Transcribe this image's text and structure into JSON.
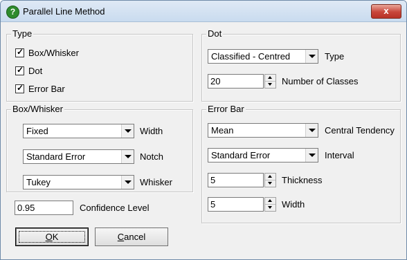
{
  "window": {
    "title": "Parallel Line Method",
    "close_label": "x"
  },
  "type_group": {
    "title": "Type",
    "items": [
      {
        "label": "Box/Whisker",
        "checked": true
      },
      {
        "label": "Dot",
        "checked": true
      },
      {
        "label": "Error Bar",
        "checked": true
      }
    ]
  },
  "dot_group": {
    "title": "Dot",
    "type_value": "Classified - Centred",
    "type_label": "Type",
    "classes_value": "20",
    "classes_label": "Number of Classes"
  },
  "box_group": {
    "title": "Box/Whisker",
    "width_value": "Fixed",
    "width_label": "Width",
    "notch_value": "Standard Error",
    "notch_label": "Notch",
    "whisker_value": "Tukey",
    "whisker_label": "Whisker"
  },
  "error_group": {
    "title": "Error Bar",
    "central_value": "Mean",
    "central_label": "Central Tendency",
    "interval_value": "Standard Error",
    "interval_label": "Interval",
    "thickness_value": "5",
    "thickness_label": "Thickness",
    "width_value": "5",
    "width_label": "Width"
  },
  "confidence": {
    "value": "0.95",
    "label": "Confidence Level"
  },
  "buttons": {
    "ok_mnemonic": "O",
    "ok_rest": "K",
    "cancel_mnemonic": "C",
    "cancel_rest": "ancel"
  }
}
